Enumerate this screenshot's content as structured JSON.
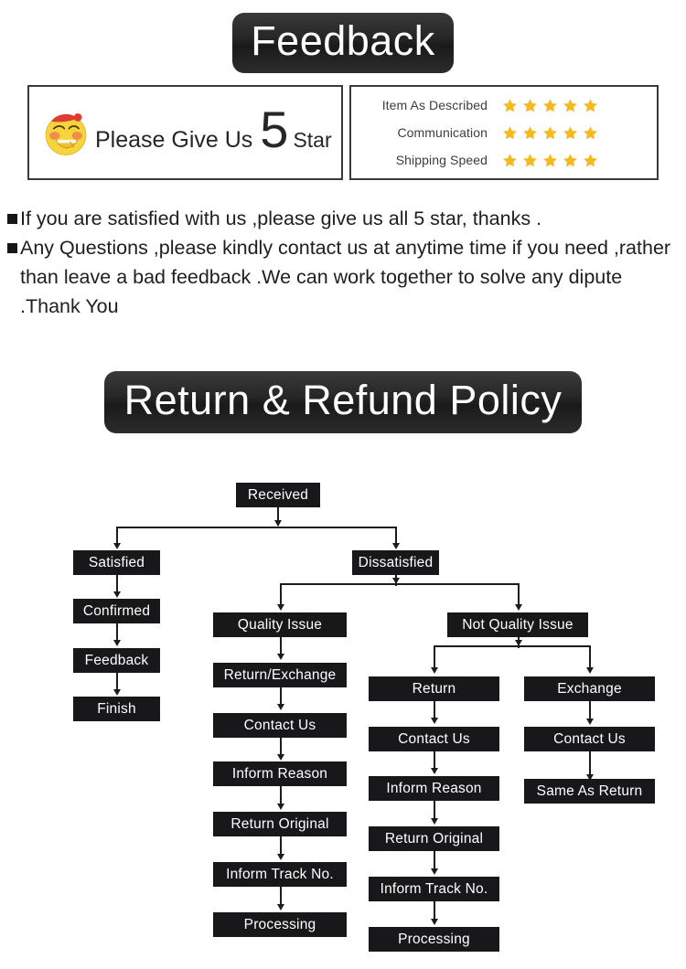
{
  "feedback_section": {
    "banner_title": "Feedback",
    "promise_box": {
      "emoji_name": "grinning-face-with-red-hat-emoji",
      "text_before": "Please Give Us",
      "star_number": "5",
      "text_after": "Star"
    },
    "rating_box": {
      "rows": [
        {
          "label": "Item As Described",
          "stars": 5
        },
        {
          "label": "Communication",
          "stars": 5
        },
        {
          "label": "Shipping Speed",
          "stars": 5
        }
      ],
      "star_color": "#F5B921"
    },
    "bullets": [
      "If you are satisfied with us ,please give us all 5 star, thanks .",
      "Any Questions ,please kindly contact us at anytime time if you need ,rather than leave a bad feedback .We can work together to solve any dipute .Thank You"
    ]
  },
  "policy_section": {
    "banner_title": "Return & Refund Policy",
    "colors": {
      "node_fill": "#18181A",
      "node_text": "#FFFFFF",
      "connector": "#1C1C1C"
    },
    "nodes": {
      "received": "Received",
      "satisfied": "Satisfied",
      "confirmed": "Confirmed",
      "feedback": "Feedback",
      "finish": "Finish",
      "dissatisfied": "Dissatisfied",
      "quality_issue": "Quality Issue",
      "return_exchange": "Return/Exchange",
      "q_contact_us": "Contact Us",
      "q_inform_reason": "Inform Reason",
      "q_return_original": "Return Original",
      "q_inform_track": "Inform Track No.",
      "q_processing": "Processing",
      "not_quality_issue": "Not Quality Issue",
      "return": "Return",
      "r_contact_us": "Contact Us",
      "r_inform_reason": "Inform Reason",
      "r_return_original": "Return Original",
      "r_inform_track": "Inform Track No.",
      "r_processing": "Processing",
      "exchange": "Exchange",
      "e_contact_us": "Contact Us",
      "e_same_as_return": "Same As Return"
    }
  }
}
